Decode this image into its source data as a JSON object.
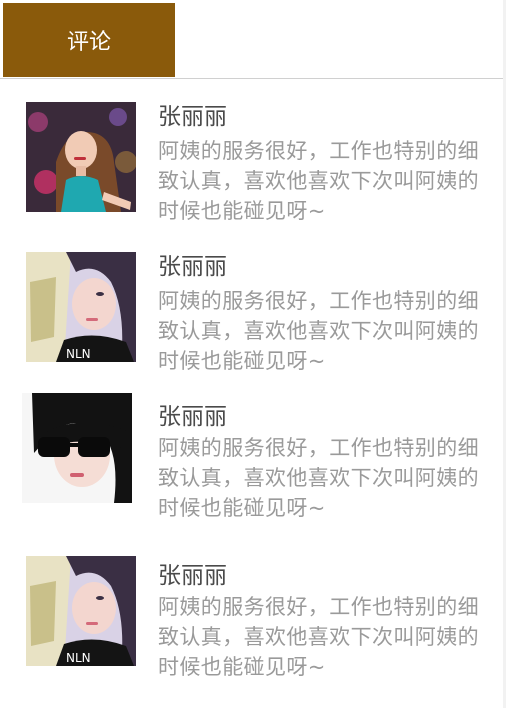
{
  "tabs": {
    "comments_label": "评论"
  },
  "colors": {
    "tab_active_bg": "#8a5a0b",
    "name": "#4a4a4a",
    "text": "#9a9a9a"
  },
  "comments": [
    {
      "name": "张丽丽",
      "text": "阿姨的服务很好，工作也特别的细致认真，喜欢他喜欢下次叫阿姨的时候也能碰见呀~",
      "avatar": "avatar-girl-teal-shirt"
    },
    {
      "name": "张丽丽",
      "text": "阿姨的服务很好，工作也特别的细致认真，喜欢他喜欢下次叫阿姨的时候也能碰见呀~",
      "avatar": "avatar-girl-book"
    },
    {
      "name": "张丽丽",
      "text": "阿姨的服务很好，工作也特别的细致认真，喜欢他喜欢下次叫阿姨的时候也能碰见呀~",
      "avatar": "avatar-girl-sunglasses"
    },
    {
      "name": "张丽丽",
      "text": "阿姨的服务很好，工作也特别的细致认真，喜欢他喜欢下次叫阿姨的时候也能碰见呀~",
      "avatar": "avatar-girl-book"
    }
  ]
}
